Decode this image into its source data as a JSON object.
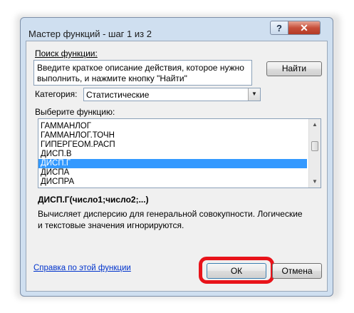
{
  "dialog": {
    "title": "Мастер функций - шаг 1 из 2",
    "help_button": "?",
    "close_button": "✕"
  },
  "search": {
    "label": "Поиск функции:",
    "value": "Введите краткое описание действия, которое нужно выполнить, и нажмите кнопку \"Найти\"",
    "find_button": "Найти"
  },
  "category": {
    "label": "Категория:",
    "selected": "Статистические"
  },
  "function_list": {
    "label": "Выберите функцию:",
    "items": [
      "ГАММАНЛОГ",
      "ГАММАНЛОГ.ТОЧН",
      "ГИПЕРГЕОМ.РАСП",
      "ДИСП.В",
      "ДИСП.Г",
      "ДИСПА",
      "ДИСПРА"
    ],
    "selected": "ДИСП.Г"
  },
  "details": {
    "signature": "ДИСП.Г(число1;число2;...)",
    "description": "Вычисляет дисперсию для генеральной совокупности. Логические и текстовые значения игнорируются."
  },
  "footer": {
    "help_link": "Справка по этой функции",
    "ok_button": "ОК",
    "cancel_button": "Отмена"
  },
  "colors": {
    "selection": "#3399ff",
    "highlight_ring": "#e8131a",
    "link": "#0033cc"
  }
}
